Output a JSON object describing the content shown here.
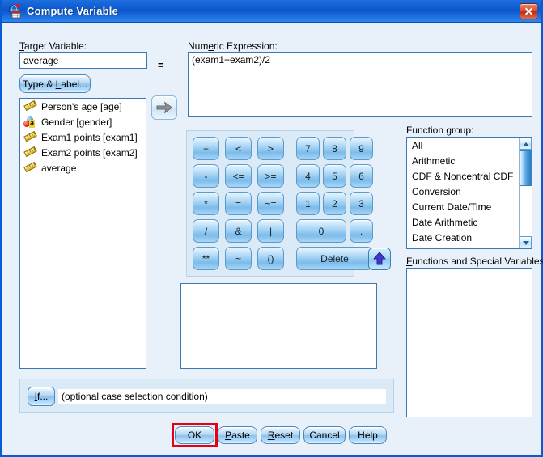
{
  "window": {
    "title": "Compute Variable",
    "icon": "spss-compute-icon",
    "close_label": "Close",
    "frame_color": "#0a5bd3",
    "background_color": "#e8f1fa"
  },
  "target_variable": {
    "label": "Target Variable:",
    "label_accel": "T",
    "value": "average",
    "equals_sign": "="
  },
  "type_label_button": {
    "text": "Type & Label...",
    "accel": "L"
  },
  "variable_list": {
    "items": [
      {
        "text": "Person's age [age]",
        "icon": "scale-ruler-icon"
      },
      {
        "text": "Gender [gender]",
        "icon": "nominal-string-icon"
      },
      {
        "text": "Exam1 points [exam1]",
        "icon": "scale-ruler-icon"
      },
      {
        "text": "Exam2 points [exam2]",
        "icon": "scale-ruler-icon"
      },
      {
        "text": "average",
        "icon": "scale-ruler-icon"
      }
    ]
  },
  "move_arrow_button": {
    "icon": "arrow-right-icon",
    "state": "disabled"
  },
  "numeric_expression": {
    "label": "Numeric Expression:",
    "label_accel": "e",
    "value": "(exam1+exam2)/2"
  },
  "keypad": {
    "rows": [
      [
        "+",
        "<",
        ">",
        "7",
        "8",
        "9"
      ],
      [
        "-",
        "<=",
        ">=",
        "4",
        "5",
        "6"
      ],
      [
        "*",
        "=",
        "~=",
        "1",
        "2",
        "3"
      ],
      [
        "/",
        "&",
        "|",
        "0",
        "."
      ],
      [
        "**",
        "~",
        "()",
        "Delete"
      ]
    ]
  },
  "function_group": {
    "label": "Function group:",
    "label_accel": "g",
    "items": [
      "All",
      "Arithmetic",
      "CDF & Noncentral CDF",
      "Conversion",
      "Current Date/Time",
      "Date Arithmetic",
      "Date Creation"
    ]
  },
  "up_arrow_button": {
    "icon": "arrow-up-icon",
    "state": "enabled"
  },
  "functions_special_variables": {
    "label": "Functions and Special Variables:",
    "label_accel": "F",
    "items": []
  },
  "case_selection": {
    "if_button": "If...",
    "if_accel": "I",
    "condition_text": "(optional case selection condition)"
  },
  "dialog_buttons": [
    {
      "text": "OK",
      "accel": "",
      "highlighted": true
    },
    {
      "text": "Paste",
      "accel": "P",
      "highlighted": false
    },
    {
      "text": "Reset",
      "accel": "R",
      "highlighted": false
    },
    {
      "text": "Cancel",
      "accel": "",
      "highlighted": false
    },
    {
      "text": "Help",
      "accel": "",
      "highlighted": false
    }
  ],
  "annotation": {
    "target": "OK",
    "color": "#e60012"
  }
}
